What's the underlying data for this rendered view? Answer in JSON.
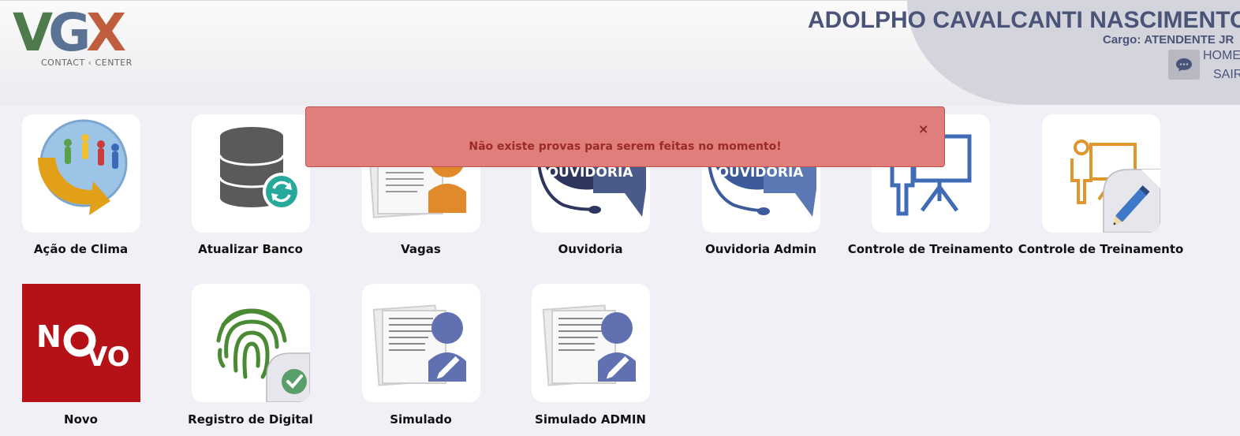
{
  "header": {
    "logo_text_v": "V",
    "logo_text_g": "G",
    "logo_text_x": "X",
    "logo_sub_left": "CONTACT",
    "logo_sub_right": "CENTER",
    "user_name": "ADOLPHO CAVALCANTI NASCIMENTO",
    "role_label": "Cargo:",
    "role_value": "ATENDENTE JR",
    "nav_home": "HOME",
    "nav_exit": "SAIR"
  },
  "alert": {
    "message": "Não existe provas para serem feitas no momento!",
    "close_symbol": "×"
  },
  "tiles": [
    {
      "label": "Ação de Clima",
      "icon": "climate-action-icon"
    },
    {
      "label": "Atualizar Banco",
      "icon": "database-refresh-icon"
    },
    {
      "label": "Vagas",
      "icon": "job-openings-icon"
    },
    {
      "label": "Ouvidoria",
      "icon": "ombudsman-icon"
    },
    {
      "label": "Ouvidoria Admin",
      "icon": "ombudsman-admin-icon"
    },
    {
      "label": "Controle de Treinamento",
      "icon": "training-board-icon"
    },
    {
      "label": "Controle de Treinamento",
      "icon": "training-edit-icon"
    },
    {
      "label": "Novo",
      "icon": "new-badge-icon"
    },
    {
      "label": "Registro de Digital",
      "icon": "fingerprint-icon"
    },
    {
      "label": "Simulado",
      "icon": "exam-document-icon"
    },
    {
      "label": "Simulado ADMIN",
      "icon": "exam-admin-icon"
    }
  ],
  "icon_text": {
    "ouvidoria": "OUVIDORIA",
    "novo_n": "N",
    "novo_vo": "VO"
  },
  "colors": {
    "brand_navy": "#4a5478",
    "alert_bg": "#e07e7c",
    "alert_text": "#9a2b28",
    "novo_red": "#b51217"
  }
}
